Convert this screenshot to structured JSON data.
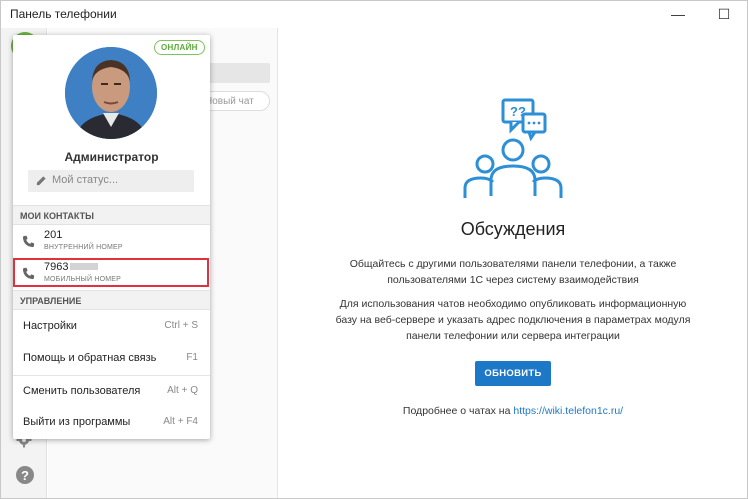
{
  "window": {
    "title": "Панель телефонии",
    "min_glyph": "—",
    "max_glyph": "☐"
  },
  "sidebar": {
    "help_glyph": "?",
    "new_chat_label": "Новый чат"
  },
  "profile": {
    "status_badge": "ОНЛАЙН",
    "name": "Администратор",
    "status_placeholder": "Мой статус..."
  },
  "contacts": {
    "section_title": "МОИ КОНТАКТЫ",
    "items": [
      {
        "number": "201",
        "type": "ВНУТРЕННИЙ НОМЕР"
      },
      {
        "number": "7963",
        "type": "МОБИЛЬНЫЙ НОМЕР"
      }
    ]
  },
  "management": {
    "section_title": "УПРАВЛЕНИЕ",
    "items": [
      {
        "label": "Настройки",
        "shortcut": "Ctrl + S"
      },
      {
        "label": "Помощь и обратная связь",
        "shortcut": "F1"
      },
      {
        "label": "Сменить пользователя",
        "shortcut": "Alt + Q"
      },
      {
        "label": "Выйти из программы",
        "shortcut": "Alt + F4"
      }
    ]
  },
  "main": {
    "heading": "Обсуждения",
    "paragraph1_line1": "Общайтесь с другими пользователями панели телефонии, а также",
    "paragraph1_line2": "пользователями 1С через систему взаимодействия",
    "paragraph2_line1": "Для использования чатов необходимо опубликовать информационную",
    "paragraph2_line2": "базу на веб-сервере и указать адрес подключения в параметрах модуля",
    "paragraph2_line3": "панели телефонии или сервера интеграции",
    "refresh_button": "ОБНОВИТЬ",
    "more_text": "Подробнее о чатах на ",
    "more_link": "https://wiki.telefon1c.ru/",
    "bubble_text": "??"
  },
  "colors": {
    "accent": "#1e78c8",
    "online": "#5aab37",
    "highlight": "#e0313c",
    "illustration": "#2d8fd5"
  }
}
